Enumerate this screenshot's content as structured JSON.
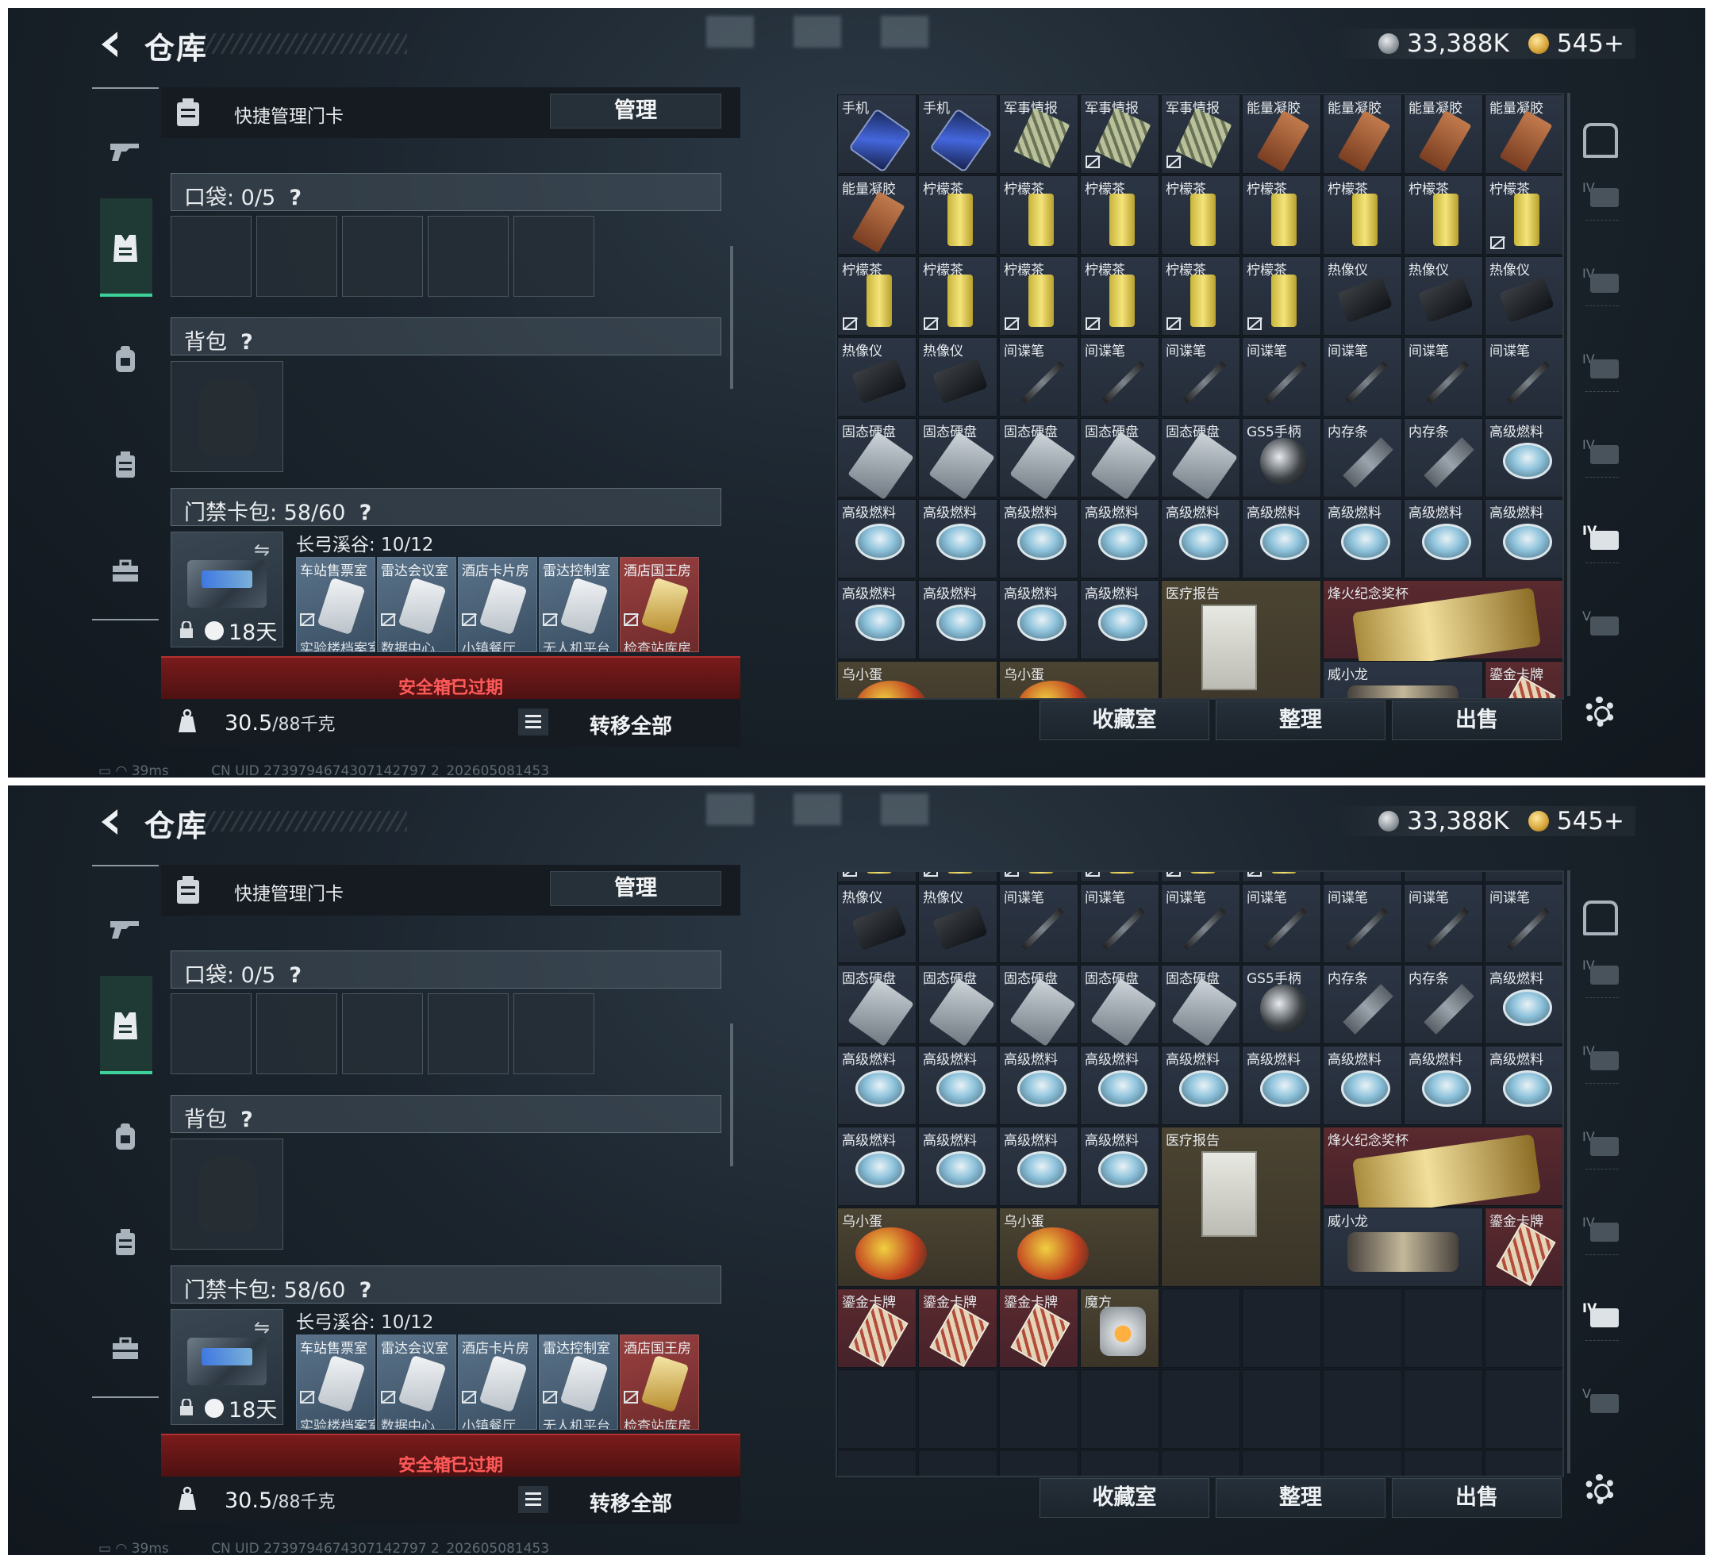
{
  "page": {
    "title": "仓库"
  },
  "currency": {
    "silver": "33,388K",
    "gold": "545+"
  },
  "left_panel": {
    "quick_manage_label": "快捷管理门卡",
    "manage_button": "管理",
    "pocket_label": "口袋: 0/5",
    "pocket_help": "?",
    "backpack_label": "背包",
    "backpack_help": "?",
    "keycard_pack_label": "门禁卡包: 58/60",
    "keycard_help": "?",
    "case_days": "18天",
    "region_label": "长弓溪谷: 10/12",
    "keycards": [
      {
        "top": "车站售票室",
        "bottom": "实验楼档案室",
        "gold": false
      },
      {
        "top": "雷达会议室",
        "bottom": "数据中心",
        "gold": false
      },
      {
        "top": "酒店卡片房",
        "bottom": "小镇餐厅",
        "gold": false
      },
      {
        "top": "雷达控制室",
        "bottom": "无人机平台",
        "gold": false
      },
      {
        "top": "酒店国王房",
        "bottom": "检查站库房",
        "gold": true
      }
    ],
    "expired_text": "安全箱已过期",
    "weight_value": "30.5",
    "weight_max": "/88千克",
    "transfer_all": "转移全部"
  },
  "actions": {
    "collection": "收藏室",
    "sort": "整理",
    "sell": "出售"
  },
  "tiers": [
    "IV",
    "IV",
    "IV",
    "IV",
    "IV",
    "V"
  ],
  "status": {
    "ping": "39ms",
    "uid": "CN UID 2739794674307142797 2_202605081453"
  },
  "grid": {
    "top_offset": 0,
    "items": [
      {
        "name": "手机",
        "art": "phone",
        "bg": "",
        "c": 0,
        "r": 0
      },
      {
        "name": "手机",
        "art": "phone",
        "bg": "",
        "c": 1,
        "r": 0
      },
      {
        "name": "军事情报",
        "art": "book",
        "bg": "",
        "c": 2,
        "r": 0
      },
      {
        "name": "军事情报",
        "art": "book",
        "bg": "",
        "c": 3,
        "r": 0,
        "nolock": true
      },
      {
        "name": "军事情报",
        "art": "book",
        "bg": "",
        "c": 4,
        "r": 0,
        "nolock": true
      },
      {
        "name": "能量凝胶",
        "art": "bar",
        "bg": "",
        "c": 5,
        "r": 0
      },
      {
        "name": "能量凝胶",
        "art": "bar",
        "bg": "",
        "c": 6,
        "r": 0
      },
      {
        "name": "能量凝胶",
        "art": "bar",
        "bg": "",
        "c": 7,
        "r": 0
      },
      {
        "name": "能量凝胶",
        "art": "bar",
        "bg": "",
        "c": 8,
        "r": 0
      },
      {
        "name": "能量凝胶",
        "art": "bar",
        "bg": "",
        "c": 0,
        "r": 1
      },
      {
        "name": "柠檬茶",
        "art": "can",
        "bg": "",
        "c": 1,
        "r": 1
      },
      {
        "name": "柠檬茶",
        "art": "can",
        "bg": "",
        "c": 2,
        "r": 1
      },
      {
        "name": "柠檬茶",
        "art": "can",
        "bg": "",
        "c": 3,
        "r": 1
      },
      {
        "name": "柠檬茶",
        "art": "can",
        "bg": "",
        "c": 4,
        "r": 1
      },
      {
        "name": "柠檬茶",
        "art": "can",
        "bg": "",
        "c": 5,
        "r": 1
      },
      {
        "name": "柠檬茶",
        "art": "can",
        "bg": "",
        "c": 6,
        "r": 1
      },
      {
        "name": "柠檬茶",
        "art": "can",
        "bg": "",
        "c": 7,
        "r": 1
      },
      {
        "name": "柠檬茶",
        "art": "can",
        "bg": "",
        "c": 8,
        "r": 1,
        "nolock": true
      },
      {
        "name": "柠檬茶",
        "art": "can",
        "bg": "",
        "c": 0,
        "r": 2,
        "nolock": true
      },
      {
        "name": "柠檬茶",
        "art": "can",
        "bg": "",
        "c": 1,
        "r": 2,
        "nolock": true
      },
      {
        "name": "柠檬茶",
        "art": "can",
        "bg": "",
        "c": 2,
        "r": 2,
        "nolock": true
      },
      {
        "name": "柠檬茶",
        "art": "can",
        "bg": "",
        "c": 3,
        "r": 2,
        "nolock": true
      },
      {
        "name": "柠檬茶",
        "art": "can",
        "bg": "",
        "c": 4,
        "r": 2,
        "nolock": true
      },
      {
        "name": "柠檬茶",
        "art": "can",
        "bg": "",
        "c": 5,
        "r": 2,
        "nolock": true
      },
      {
        "name": "热像仪",
        "art": "thermal",
        "bg": "",
        "c": 6,
        "r": 2
      },
      {
        "name": "热像仪",
        "art": "thermal",
        "bg": "",
        "c": 7,
        "r": 2
      },
      {
        "name": "热像仪",
        "art": "thermal",
        "bg": "",
        "c": 8,
        "r": 2
      },
      {
        "name": "热像仪",
        "art": "thermal",
        "bg": "",
        "c": 0,
        "r": 3
      },
      {
        "name": "热像仪",
        "art": "thermal",
        "bg": "",
        "c": 1,
        "r": 3
      },
      {
        "name": "间谍笔",
        "art": "pen",
        "bg": "",
        "c": 2,
        "r": 3
      },
      {
        "name": "间谍笔",
        "art": "pen",
        "bg": "",
        "c": 3,
        "r": 3
      },
      {
        "name": "间谍笔",
        "art": "pen",
        "bg": "",
        "c": 4,
        "r": 3
      },
      {
        "name": "间谍笔",
        "art": "pen",
        "bg": "",
        "c": 5,
        "r": 3
      },
      {
        "name": "间谍笔",
        "art": "pen",
        "bg": "",
        "c": 6,
        "r": 3
      },
      {
        "name": "间谍笔",
        "art": "pen",
        "bg": "",
        "c": 7,
        "r": 3
      },
      {
        "name": "间谍笔",
        "art": "pen",
        "bg": "",
        "c": 8,
        "r": 3
      },
      {
        "name": "固态硬盘",
        "art": "ssd",
        "bg": "",
        "c": 0,
        "r": 4
      },
      {
        "name": "固态硬盘",
        "art": "ssd",
        "bg": "",
        "c": 1,
        "r": 4
      },
      {
        "name": "固态硬盘",
        "art": "ssd",
        "bg": "",
        "c": 2,
        "r": 4
      },
      {
        "name": "固态硬盘",
        "art": "ssd",
        "bg": "",
        "c": 3,
        "r": 4
      },
      {
        "name": "固态硬盘",
        "art": "ssd",
        "bg": "",
        "c": 4,
        "r": 4
      },
      {
        "name": "GS5手柄",
        "art": "gs5",
        "bg": "",
        "c": 5,
        "r": 4
      },
      {
        "name": "内存条",
        "art": "ram",
        "bg": "",
        "c": 6,
        "r": 4
      },
      {
        "name": "内存条",
        "art": "ram",
        "bg": "",
        "c": 7,
        "r": 4
      },
      {
        "name": "高级燃料",
        "art": "fuel",
        "bg": "",
        "c": 8,
        "r": 4
      },
      {
        "name": "高级燃料",
        "art": "fuel",
        "bg": "",
        "c": 0,
        "r": 5
      },
      {
        "name": "高级燃料",
        "art": "fuel",
        "bg": "",
        "c": 1,
        "r": 5
      },
      {
        "name": "高级燃料",
        "art": "fuel",
        "bg": "",
        "c": 2,
        "r": 5
      },
      {
        "name": "高级燃料",
        "art": "fuel",
        "bg": "",
        "c": 3,
        "r": 5
      },
      {
        "name": "高级燃料",
        "art": "fuel",
        "bg": "",
        "c": 4,
        "r": 5
      },
      {
        "name": "高级燃料",
        "art": "fuel",
        "bg": "",
        "c": 5,
        "r": 5
      },
      {
        "name": "高级燃料",
        "art": "fuel",
        "bg": "",
        "c": 6,
        "r": 5
      },
      {
        "name": "高级燃料",
        "art": "fuel",
        "bg": "",
        "c": 7,
        "r": 5
      },
      {
        "name": "高级燃料",
        "art": "fuel",
        "bg": "",
        "c": 8,
        "r": 5
      },
      {
        "name": "高级燃料",
        "art": "fuel",
        "bg": "",
        "c": 0,
        "r": 6
      },
      {
        "name": "高级燃料",
        "art": "fuel",
        "bg": "",
        "c": 1,
        "r": 6
      },
      {
        "name": "高级燃料",
        "art": "fuel",
        "bg": "",
        "c": 2,
        "r": 6
      },
      {
        "name": "高级燃料",
        "art": "fuel",
        "bg": "",
        "c": 3,
        "r": 6
      },
      {
        "name": "医疗报告",
        "art": "report",
        "bg": "tan",
        "c": 4,
        "r": 6,
        "w": 2,
        "h": 2
      },
      {
        "name": "烽火纪念奖杯",
        "art": "trophy",
        "bg": "red",
        "c": 6,
        "r": 6,
        "w": 3,
        "h": 1
      },
      {
        "name": "乌小蛋",
        "art": "egg",
        "bg": "tan",
        "c": 0,
        "r": 7,
        "w": 2,
        "h": 1
      },
      {
        "name": "乌小蛋",
        "art": "egg",
        "bg": "tan",
        "c": 2,
        "r": 7,
        "w": 2,
        "h": 1
      },
      {
        "name": "威小龙",
        "art": "dragon",
        "bg": "",
        "c": 6,
        "r": 7,
        "w": 2,
        "h": 1
      },
      {
        "name": "鎏金卡牌",
        "art": "card",
        "bg": "red",
        "c": 8,
        "r": 7
      },
      {
        "name": "鎏金卡牌",
        "art": "card",
        "bg": "red",
        "c": 0,
        "r": 8
      },
      {
        "name": "鎏金卡牌",
        "art": "card",
        "bg": "red",
        "c": 1,
        "r": 8
      },
      {
        "name": "鎏金卡牌",
        "art": "card",
        "bg": "red",
        "c": 2,
        "r": 8
      },
      {
        "name": "魔方",
        "art": "cube",
        "bg": "tan",
        "c": 3,
        "r": 8
      }
    ]
  },
  "frames": [
    {
      "grid_scroll_rows": 0,
      "active_tier": 4
    },
    {
      "grid_scroll_rows": 2.85,
      "active_tier": 4
    }
  ]
}
